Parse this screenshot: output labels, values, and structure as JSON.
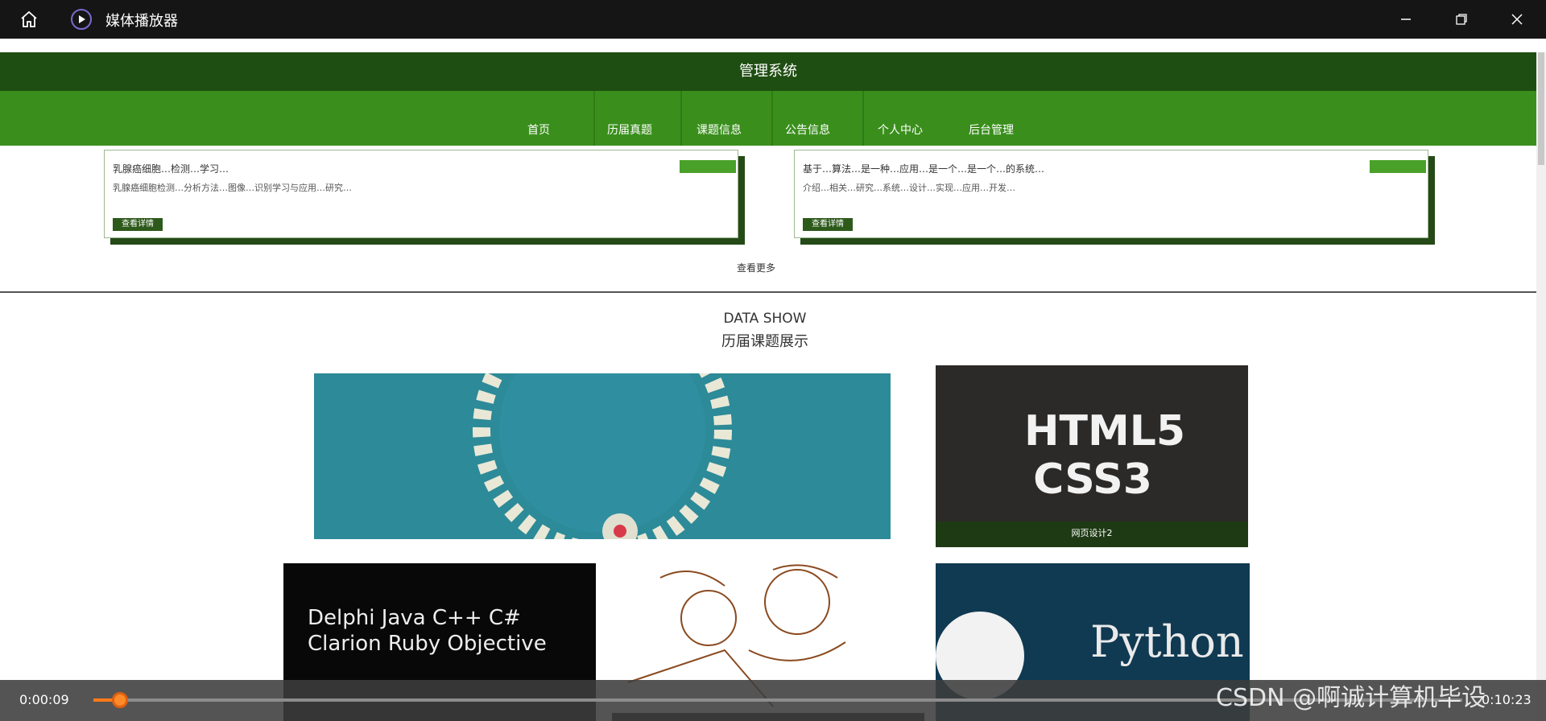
{
  "window": {
    "title": "媒体播放器",
    "home_icon": "home-icon",
    "app_icon": "play-circle-icon",
    "buttons": [
      "minimize-icon",
      "restore-icon",
      "close-icon"
    ]
  },
  "site": {
    "header_title": "管理系统",
    "nav": [
      "首页",
      "历届真题",
      "课题信息",
      "公告信息",
      "个人中心",
      "后台管理"
    ],
    "cards": [
      {
        "title": "乳腺癌细胞…检测…学习…",
        "text": "乳腺癌细胞检测…分析方法…图像…识别学习与应用…研究…",
        "button": "查看详情"
      },
      {
        "title": "基于…算法…是一种…应用…是一个…是一个…的系统…",
        "text": "介绍…相关…研究…系统…设计…实现…应用…开发…",
        "button": "查看详情"
      }
    ],
    "more_label": "查看更多",
    "section_en": "DATA SHOW",
    "section_cn": "历届课题展示",
    "thumbs": [
      {
        "label": "",
        "name": "gear"
      },
      {
        "label": "HTML5",
        "sub": "CSS3",
        "caption": "网页设计2",
        "name": "html5"
      },
      {
        "label": "Delphi Java C++ C# Clarion Ruby Objective",
        "name": "code-cloud"
      },
      {
        "label": "",
        "name": "sketch"
      },
      {
        "label": "Python",
        "name": "python"
      }
    ]
  },
  "player": {
    "current_time": "0:00:09",
    "total_time": "0:10:23",
    "progress": 0.014,
    "watermark": "CSDN @啊诚计算机毕设"
  },
  "colors": {
    "header_bg": "#1f4e12",
    "nav_bg": "#3a8f1c",
    "accent": "#ff7a1a"
  }
}
